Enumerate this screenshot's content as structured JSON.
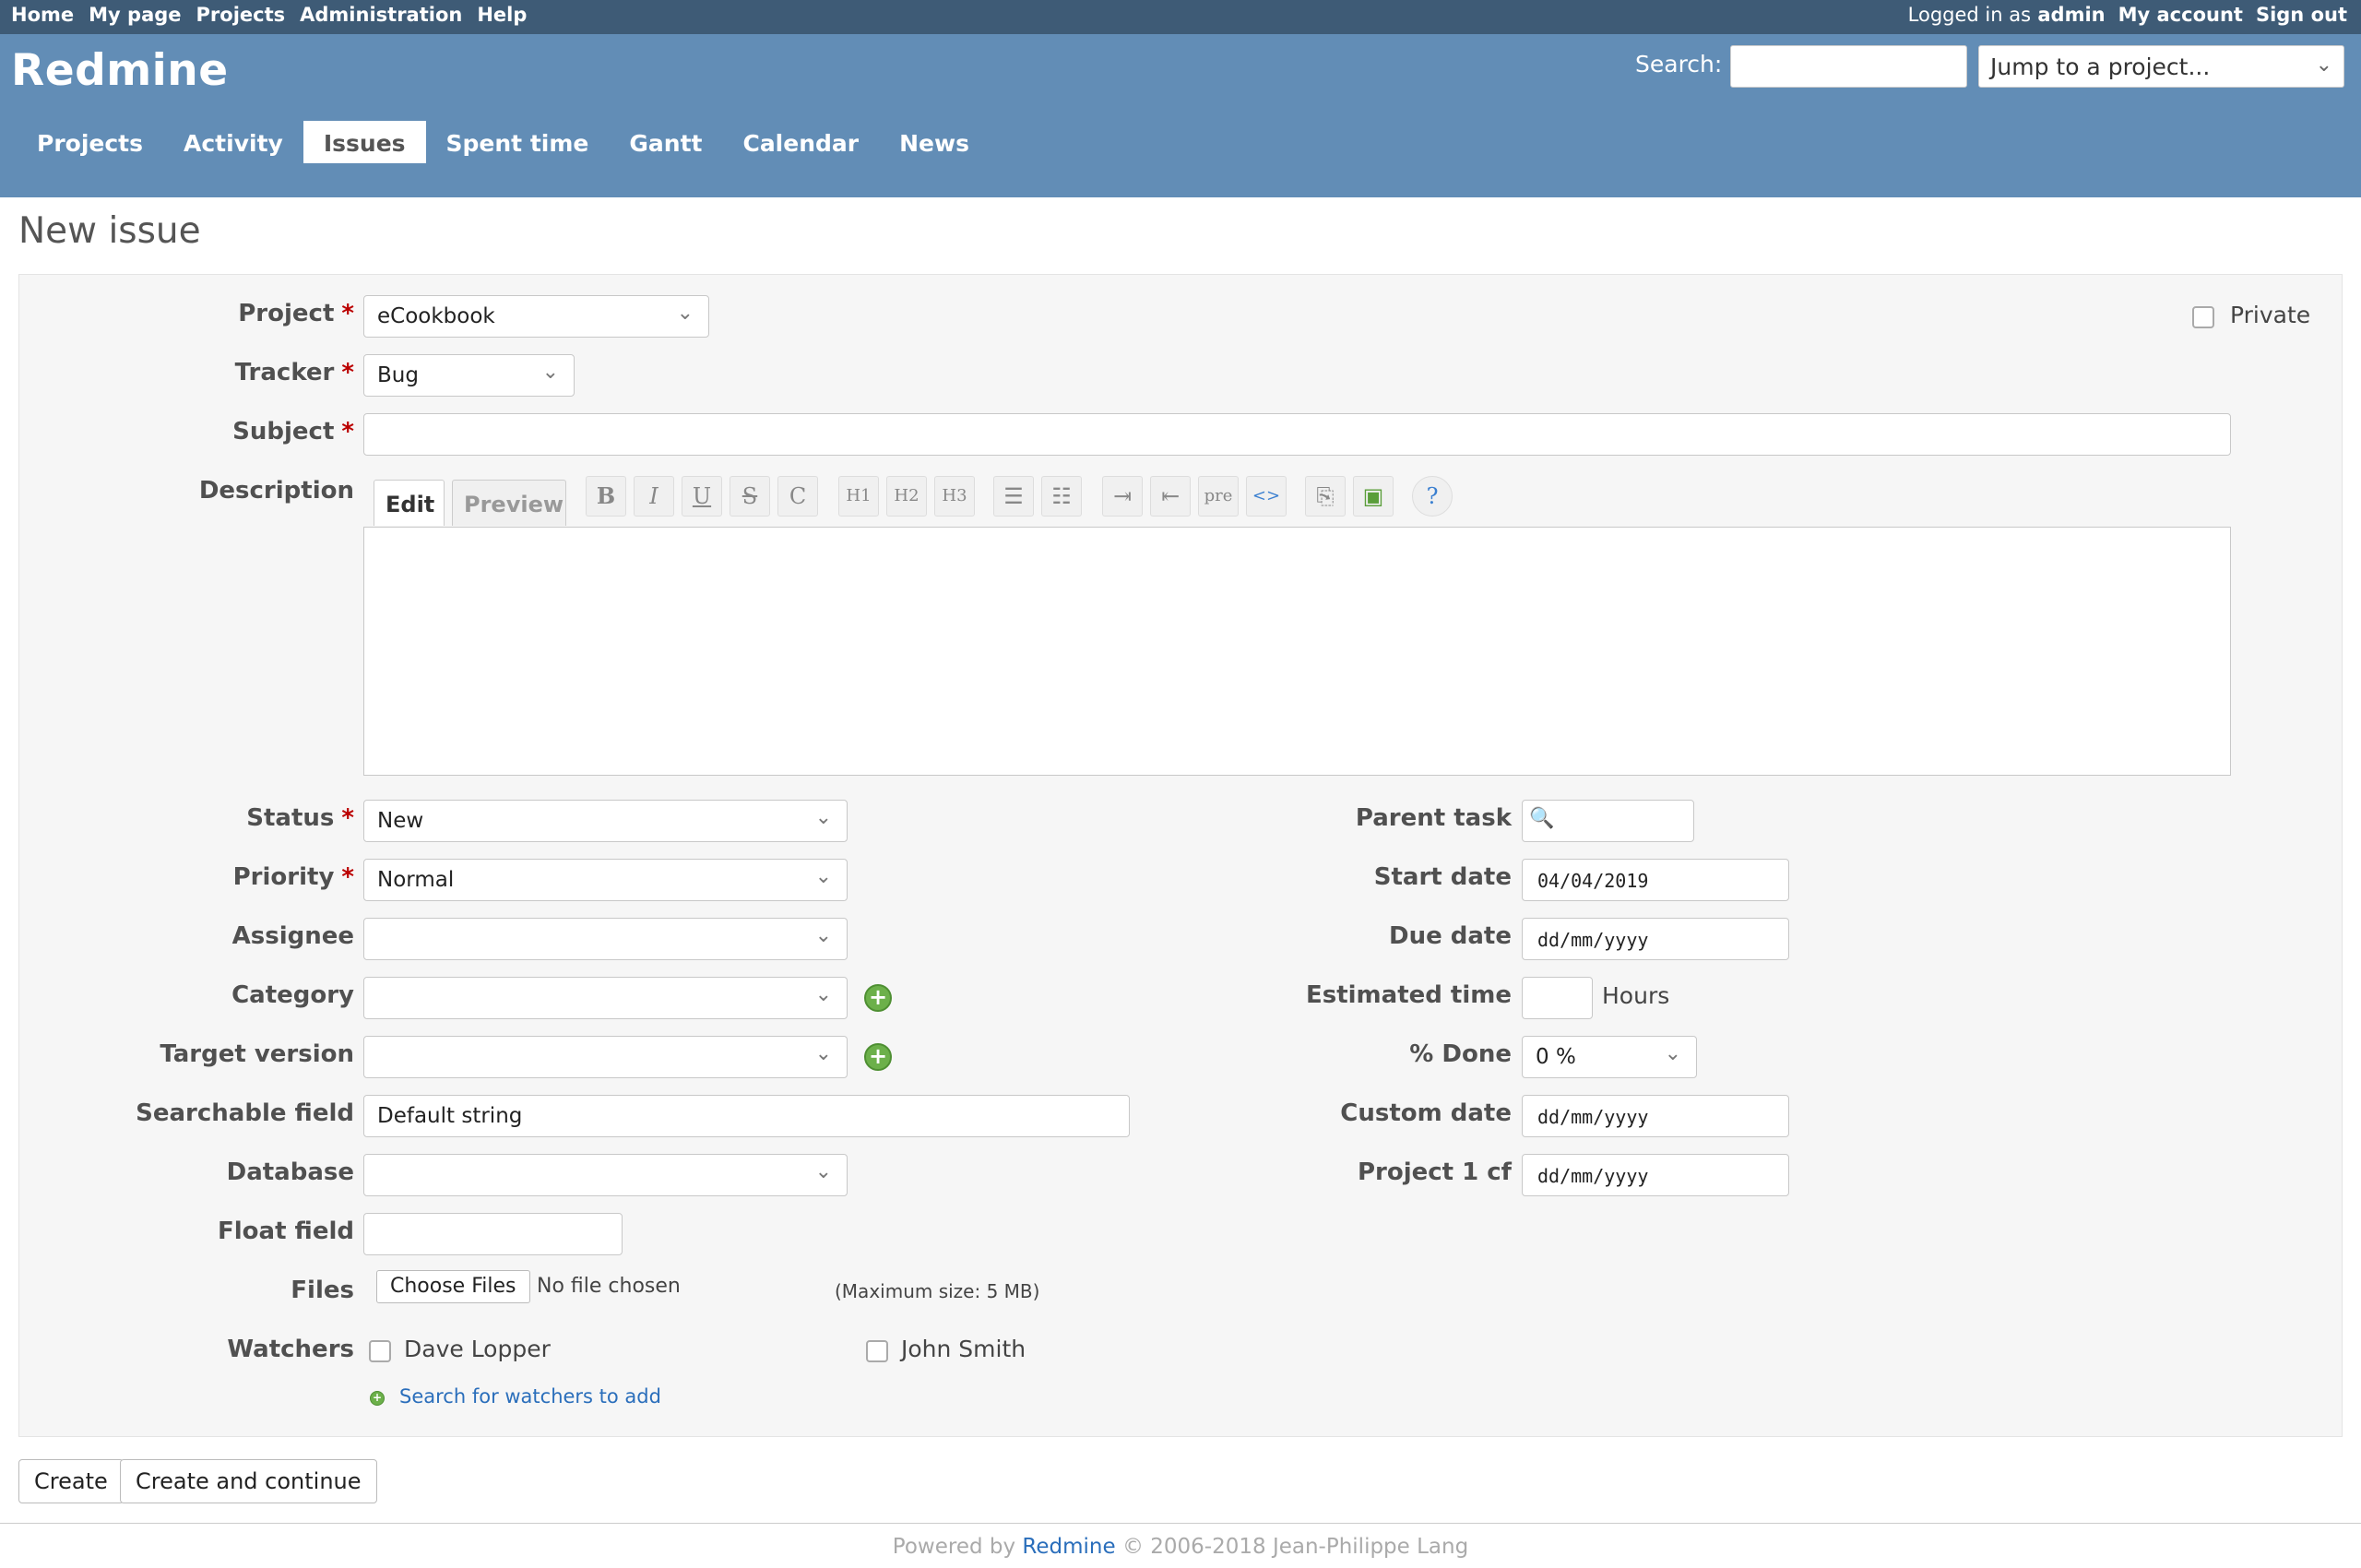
{
  "top_menu": {
    "left_items": [
      "Home",
      "My page",
      "Projects",
      "Administration",
      "Help"
    ],
    "logged_in_prefix": "Logged in as",
    "logged_in_user": "admin",
    "my_account": "My account",
    "sign_out": "Sign out"
  },
  "header": {
    "title": "Redmine",
    "search_label": "Search:",
    "search_value": "",
    "jump_placeholder": "Jump to a project..."
  },
  "main_menu": {
    "tabs": [
      {
        "label": "Projects",
        "selected": false
      },
      {
        "label": "Activity",
        "selected": false
      },
      {
        "label": "Issues",
        "selected": true
      },
      {
        "label": "Spent time",
        "selected": false
      },
      {
        "label": "Gantt",
        "selected": false
      },
      {
        "label": "Calendar",
        "selected": false
      },
      {
        "label": "News",
        "selected": false
      }
    ]
  },
  "page_title": "New issue",
  "form": {
    "project": {
      "label": "Project",
      "value": "eCookbook"
    },
    "private": {
      "label": "Private",
      "checked": false
    },
    "tracker": {
      "label": "Tracker",
      "value": "Bug"
    },
    "subject": {
      "label": "Subject",
      "value": ""
    },
    "description": {
      "label": "Description",
      "tab_edit": "Edit",
      "tab_preview": "Preview",
      "value": "",
      "toolbar": [
        {
          "name": "bold-icon",
          "glyph": "B"
        },
        {
          "name": "italic-icon",
          "glyph": "I"
        },
        {
          "name": "underline-icon",
          "glyph": "U"
        },
        {
          "name": "strikethrough-icon",
          "glyph": "S"
        },
        {
          "name": "code-icon",
          "glyph": "C"
        },
        {
          "name": "heading1-icon",
          "glyph": "H1"
        },
        {
          "name": "heading2-icon",
          "glyph": "H2"
        },
        {
          "name": "heading3-icon",
          "glyph": "H3"
        },
        {
          "name": "unordered-list-icon",
          "glyph": "☰"
        },
        {
          "name": "ordered-list-icon",
          "glyph": "☷"
        },
        {
          "name": "indent-icon",
          "glyph": "⇥"
        },
        {
          "name": "outdent-icon",
          "glyph": "⇤"
        },
        {
          "name": "pre-icon",
          "glyph": "pre"
        },
        {
          "name": "code-block-icon",
          "glyph": "<>"
        },
        {
          "name": "link-icon",
          "glyph": "⎘"
        },
        {
          "name": "image-icon",
          "glyph": "▣"
        },
        {
          "name": "help-icon",
          "glyph": "?"
        }
      ]
    },
    "left": {
      "status": {
        "label": "Status",
        "value": "New"
      },
      "priority": {
        "label": "Priority",
        "value": "Normal"
      },
      "assignee": {
        "label": "Assignee",
        "value": ""
      },
      "category": {
        "label": "Category",
        "value": ""
      },
      "target_version": {
        "label": "Target version",
        "value": ""
      },
      "searchable_field": {
        "label": "Searchable field",
        "value": "Default string"
      },
      "database": {
        "label": "Database",
        "value": ""
      },
      "float_field": {
        "label": "Float field",
        "value": ""
      }
    },
    "right": {
      "parent_task": {
        "label": "Parent task",
        "value": ""
      },
      "start_date": {
        "label": "Start date",
        "value": "04/04/2019"
      },
      "due_date": {
        "label": "Due date",
        "value": "dd/mm/yyyy"
      },
      "estimated_time": {
        "label": "Estimated time",
        "value": "",
        "unit": "Hours"
      },
      "done_ratio": {
        "label": "% Done",
        "value": "0 %"
      },
      "custom_date": {
        "label": "Custom date",
        "value": "dd/mm/yyyy"
      },
      "project_1_cf": {
        "label": "Project 1 cf",
        "value": "dd/mm/yyyy"
      }
    },
    "files": {
      "label": "Files",
      "button": "Choose Files",
      "status": "No file chosen",
      "max_size": "(Maximum size: 5 MB)"
    },
    "watchers": {
      "label": "Watchers",
      "users": [
        {
          "name": "Dave Lopper",
          "checked": false
        },
        {
          "name": "John Smith",
          "checked": false
        }
      ],
      "search_link": "Search for watchers to add"
    }
  },
  "buttons": {
    "create": "Create",
    "create_continue": "Create and continue"
  },
  "footer": {
    "prefix": "Powered by",
    "link": "Redmine",
    "suffix": "© 2006-2018 Jean-Philippe Lang"
  },
  "colors": {
    "top_menu": "#3e5b76",
    "header": "#628db6",
    "required": "#bb0000",
    "link": "#2a6ebb",
    "add_icon": "#6cb04a"
  }
}
